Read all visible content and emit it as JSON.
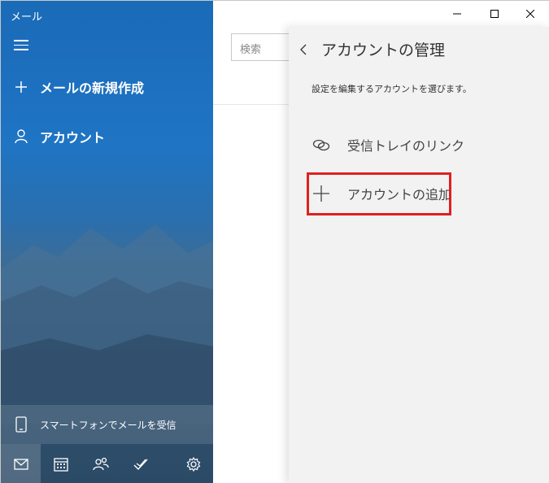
{
  "app": {
    "title": "メール"
  },
  "sidebar": {
    "new_mail_label": "メールの新規作成",
    "account_label": "アカウント",
    "phone_label": "スマートフォンでメールを受信"
  },
  "search": {
    "placeholder": "検索"
  },
  "panel": {
    "title": "アカウントの管理",
    "description": "設定を編集するアカウントを選びます。",
    "link_inbox_label": "受信トレイのリンク",
    "add_account_label": "アカウントの追加"
  },
  "colors": {
    "sidebar_blue": "#1f74c4",
    "panel_bg": "#f2f2f2",
    "highlight_red": "#e02020"
  }
}
